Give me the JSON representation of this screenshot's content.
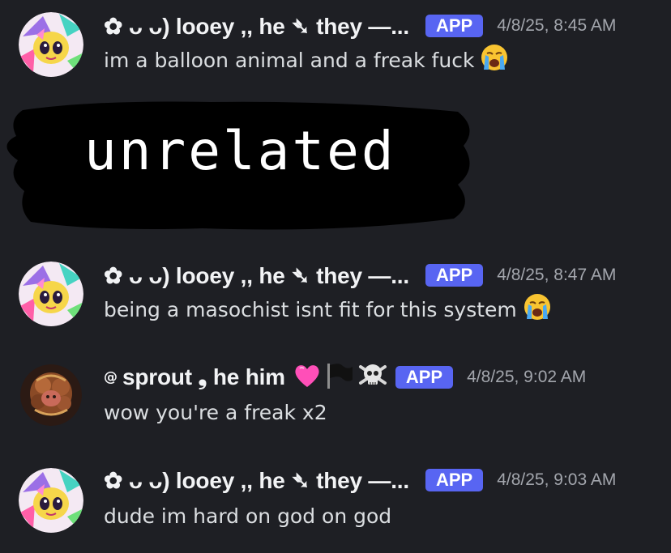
{
  "messages": [
    {
      "username": "✿ ᴗ ᴗ) looey ,, he ➴ they —...",
      "badge": "APP",
      "timestamp": "4/8/25, 8:45 AM",
      "text": "im a balloon animal and a freak fuck",
      "emoji": "loudly-crying-emoji"
    },
    {
      "username": "✿ ᴗ ᴗ) looey ,, he ➴ they —...",
      "badge": "APP",
      "timestamp": "4/8/25, 8:47 AM",
      "text": "being a masochist isnt fit for this system",
      "emoji": "loudly-crying-emoji"
    },
    {
      "at_prefix": "@",
      "username": "sprout ❟ he him",
      "username_emojis": [
        "pink-heart-emoji",
        "black-flag-emoji",
        "skull-and-crossbones-emoji"
      ],
      "badge": "APP",
      "timestamp": "4/8/25, 9:02 AM",
      "text": "wow you're a freak x2"
    },
    {
      "username": "✿ ᴗ ᴗ) looey ,, he ➴ they —...",
      "badge": "APP",
      "timestamp": "4/8/25, 9:03 AM",
      "text": "dude im hard on god on god"
    }
  ],
  "embedded_image": {
    "text": "unrelated",
    "background": "#000000",
    "text_color": "#ffffff"
  },
  "colors": {
    "background": "#1e1f24",
    "badge": "#5865f2",
    "username": "#f2f3f5",
    "message_text": "#dbdee1",
    "timestamp": "#a3a6ad"
  }
}
